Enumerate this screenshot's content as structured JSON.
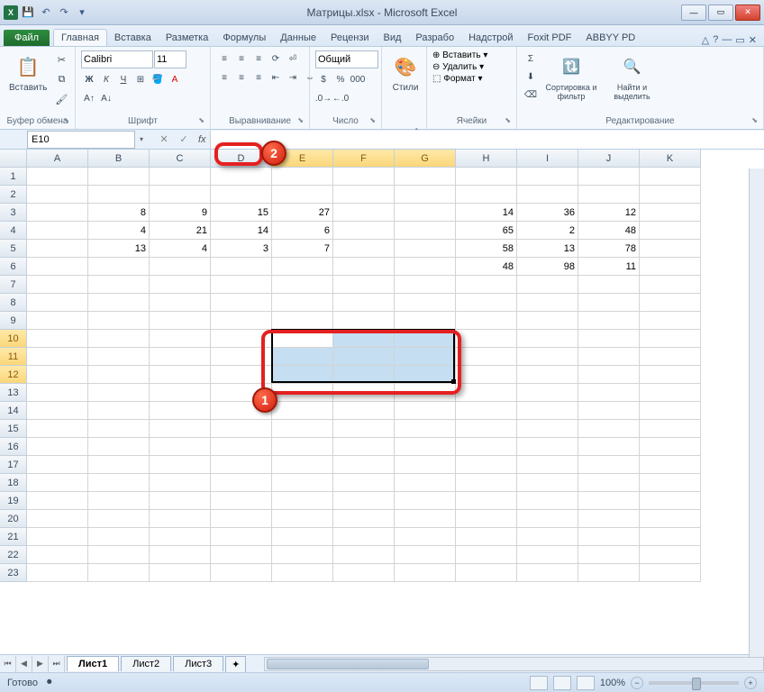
{
  "title": "Матрицы.xlsx - Microsoft Excel",
  "qat": {
    "save": "💾",
    "undo": "↶",
    "redo": "↷"
  },
  "tabs": {
    "file": "Файл",
    "items": [
      "Главная",
      "Вставка",
      "Разметка",
      "Формулы",
      "Данные",
      "Рецензи",
      "Вид",
      "Разрабо",
      "Надстрой",
      "Foxit PDF",
      "ABBYY PD"
    ],
    "active": 0
  },
  "ribbon": {
    "clipboard": {
      "paste": "Вставить",
      "label": "Буфер обмена"
    },
    "font": {
      "name": "Calibri",
      "size": "11",
      "label": "Шрифт"
    },
    "alignment": {
      "label": "Выравнивание"
    },
    "number": {
      "format": "Общий",
      "label": "Число"
    },
    "styles": {
      "btn": "Стили",
      "label": ""
    },
    "cells": {
      "insert": "Вставить",
      "delete": "Удалить",
      "format": "Формат",
      "label": "Ячейки"
    },
    "editing": {
      "sort": "Сортировка и фильтр",
      "find": "Найти и выделить",
      "label": "Редактирование"
    }
  },
  "namebox": "E10",
  "formula": "",
  "cols": [
    "A",
    "B",
    "C",
    "D",
    "E",
    "F",
    "G",
    "H",
    "I",
    "J",
    "K"
  ],
  "selected_cols": [
    "E",
    "F",
    "G"
  ],
  "selected_rows": [
    10,
    11,
    12
  ],
  "rows": 23,
  "matrix1": {
    "r3": {
      "B": "8",
      "C": "9",
      "D": "15",
      "E": "27"
    },
    "r4": {
      "B": "4",
      "C": "21",
      "D": "14",
      "E": "6"
    },
    "r5": {
      "B": "13",
      "C": "4",
      "D": "3",
      "E": "7"
    }
  },
  "matrix2": {
    "r3": {
      "H": "14",
      "I": "36",
      "J": "12"
    },
    "r4": {
      "H": "65",
      "I": "2",
      "J": "48"
    },
    "r5": {
      "H": "58",
      "I": "13",
      "J": "78"
    },
    "r6": {
      "H": "48",
      "I": "98",
      "J": "11"
    }
  },
  "sheets": {
    "active": "Лист1",
    "others": [
      "Лист2",
      "Лист3"
    ]
  },
  "status": {
    "ready": "Готово",
    "zoom": "100%"
  },
  "callouts": {
    "one": "1",
    "two": "2"
  }
}
